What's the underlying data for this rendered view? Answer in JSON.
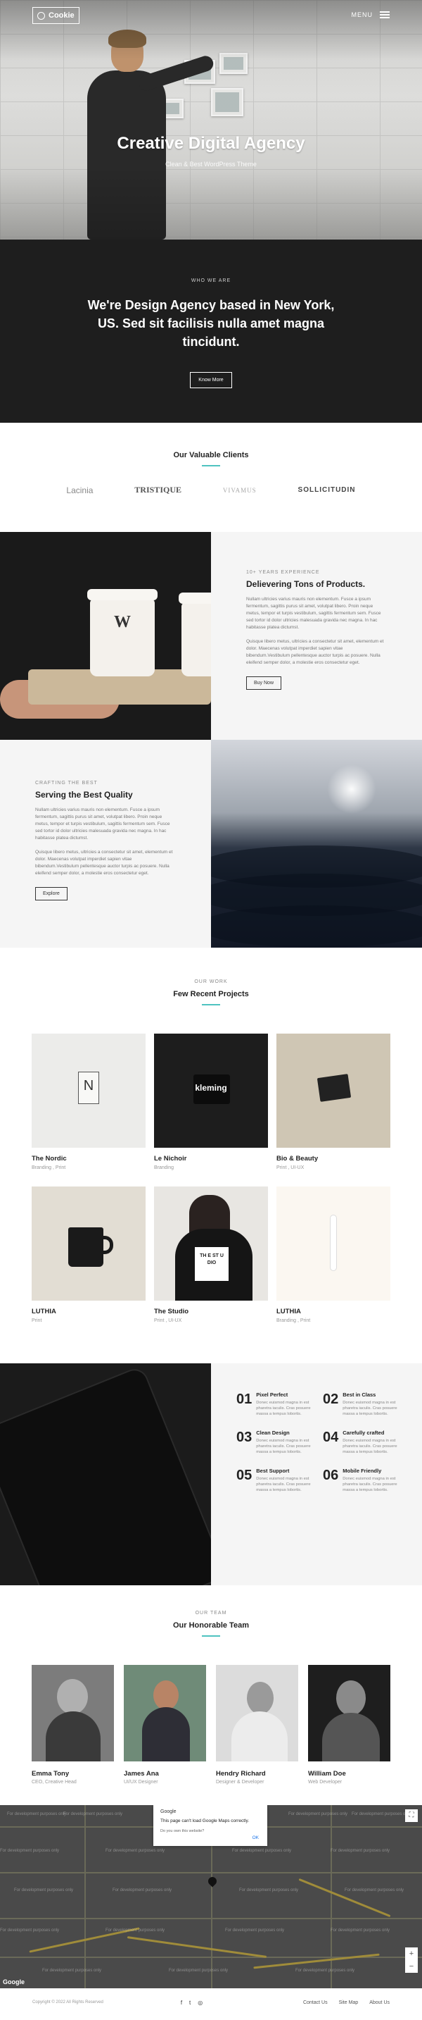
{
  "header": {
    "logo_text": "Cookie",
    "menu_label": "MENU",
    "hero_title": "Creative Digital Agency",
    "hero_subtitle": "Clean & Best WordPress Theme"
  },
  "who": {
    "eyebrow": "WHO WE ARE",
    "heading": "We're Design Agency based in New York, US. Sed sit facilisis nulla amet magna tincidunt.",
    "button": "Know More"
  },
  "clients": {
    "title": "Our Valuable Clients",
    "logos": [
      "Lacinia",
      "TRISTIQUE",
      "VIVAMUS",
      "SOLLICITUDIN"
    ]
  },
  "products": {
    "eyebrow": "10+ YEARS EXPERIENCE",
    "title": "Delievering Tons of Products.",
    "p1": "Nullam ultricies varius mauris non elementum. Fusce a ipsum fermentum, sagittis purus sit amet, volutpat libero. Proin neque metus, tempor et turpis vestibulum, sagittis fermentum sem. Fusce sed tortor id dolor ultricies malesuada gravida nec magna. In hac habitasse platea dictumst.",
    "p2": "Quisque libero metus, ultricies a consectetur sit amet, elementum et dolor. Maecenas volutpat imperdiet sapien vitae bibendum.Vestibulum pellentesque auctor turpis ac posuere. Nulla eleifend semper dolor, a molestie eros consectetur eget.",
    "button": "Buy Now",
    "cup_mark": "W"
  },
  "quality": {
    "eyebrow": "CRAFTING THE BEST",
    "title": "Serving the Best Quality",
    "p1": "Nullam ultricies varius mauris non elementum. Fusce a ipsum fermentum, sagittis purus sit amet, volutpat libero. Proin neque metus, tempor et turpis vestibulum, sagittis fermentum sem. Fusce sed tortor id dolor ultricies malesuada gravida nec magna. In hac habitasse platea dictumst.",
    "p2": "Quisque libero metus, ultricies a consectetur sit amet, elementum et dolor. Maecenas volutpat imperdiet sapien vitae bibendum.Vestibulum pellentesque auctor turpis ac posuere. Nulla eleifend semper dolor, a molestie eros consectetur eget.",
    "button": "Explore"
  },
  "works": {
    "eyebrow": "OUR WORK",
    "title": "Few Recent Projects",
    "items": [
      {
        "title": "The Nordic",
        "cats": "Branding , Print",
        "mark": "N"
      },
      {
        "title": "Le Nichoir",
        "cats": "Branding",
        "mark": "kleming"
      },
      {
        "title": "Bio & Beauty",
        "cats": "Print , UI-UX",
        "mark": ""
      },
      {
        "title": "LUTHIA",
        "cats": "Print",
        "mark": ""
      },
      {
        "title": "The Studio",
        "cats": "Print , UI-UX",
        "mark": "TH E ST U DIO"
      },
      {
        "title": "LUTHIA",
        "cats": "Branding , Print",
        "mark": ""
      }
    ]
  },
  "features": {
    "items": [
      {
        "num": "01",
        "title": "Pixel Perfect",
        "desc": "Donec euismod magna in est pharetra iaculis. Cras posuere massa a tempus lobortis."
      },
      {
        "num": "02",
        "title": "Best in Class",
        "desc": "Donec euismod magna in est pharetra iaculis. Cras posuere massa a tempus lobortis."
      },
      {
        "num": "03",
        "title": "Clean Design",
        "desc": "Donec euismod magna in est pharetra iaculis. Cras posuere massa a tempus lobortis."
      },
      {
        "num": "04",
        "title": "Carefully crafted",
        "desc": "Donec euismod magna in est pharetra iaculis. Cras posuere massa a tempus lobortis."
      },
      {
        "num": "05",
        "title": "Best Support",
        "desc": "Donec euismod magna in est pharetra iaculis. Cras posuere massa a tempus lobortis."
      },
      {
        "num": "06",
        "title": "Mobile Friendly",
        "desc": "Donec euismod magna in est pharetra iaculis. Cras posuere massa a tempus lobortis."
      }
    ]
  },
  "team": {
    "eyebrow": "OUR TEAM",
    "title": "Our Honorable Team",
    "members": [
      {
        "name": "Emma Tony",
        "role": "CEO, Creative Head"
      },
      {
        "name": "James Ana",
        "role": "UI/UX Designer"
      },
      {
        "name": "Hendry Richard",
        "role": "Designer & Developer"
      },
      {
        "name": "William Doe",
        "role": "Web Developer"
      }
    ]
  },
  "map": {
    "google_label": "Google",
    "message": "This page can't load Google Maps correctly.",
    "question": "Do you own this website?",
    "ok": "OK",
    "dev_text": "For development purposes only",
    "zoom_in": "+",
    "zoom_out": "−",
    "fullscreen": "⛶"
  },
  "footer": {
    "copyright": "Copyright © 2022 All Rights Reserved",
    "social": [
      "f",
      "t",
      "◎"
    ],
    "links": [
      "Contact Us",
      "Site Map",
      "About Us"
    ]
  },
  "colors": {
    "accent": "#4fc3c0",
    "dark": "#1e1e1e",
    "light_bg": "#f5f5f5"
  }
}
